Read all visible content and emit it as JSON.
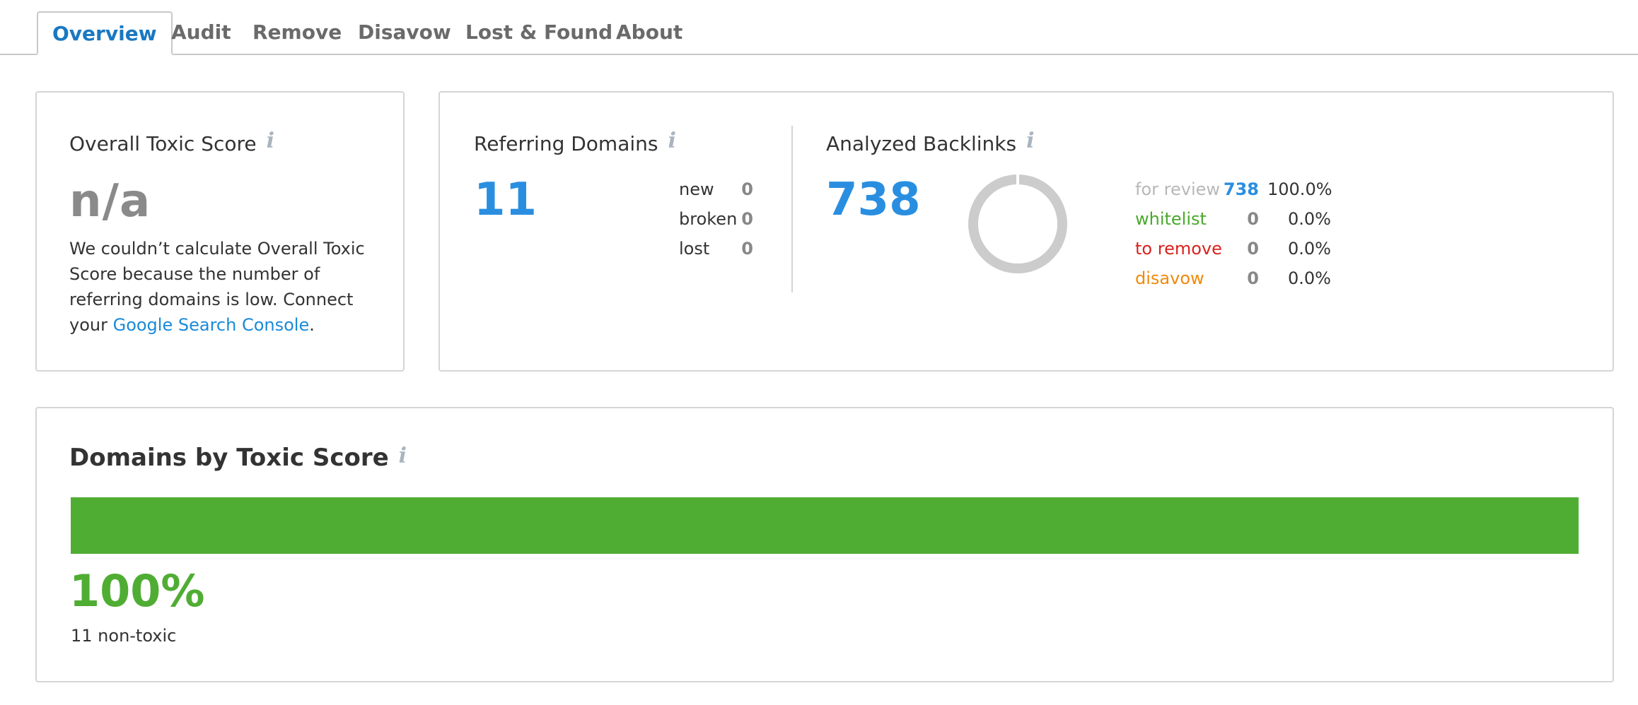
{
  "tabs": [
    {
      "label": "Overview",
      "active": true
    },
    {
      "label": "Audit"
    },
    {
      "label": "Remove"
    },
    {
      "label": "Disavow"
    },
    {
      "label": "Lost & Found"
    },
    {
      "label": "About"
    }
  ],
  "toxic_score": {
    "title": "Overall Toxic Score",
    "value": "n/a",
    "description": "We couldn’t calculate Overall Toxic Score because the number of referring domains is low. Connect your ",
    "link_text": "Google Search Console",
    "trailing": "."
  },
  "referring_domains": {
    "title": "Referring Domains",
    "value": "11",
    "stats": [
      {
        "label": "new",
        "value": "0"
      },
      {
        "label": "broken",
        "value": "0"
      },
      {
        "label": "lost",
        "value": "0"
      }
    ]
  },
  "analyzed_backlinks": {
    "title": "Analyzed Backlinks",
    "value": "738",
    "rows": [
      {
        "label": "for review",
        "count": "738",
        "pct": "100.0%",
        "label_color": "#b8b8b8",
        "count_color": "#2a8ee0"
      },
      {
        "label": "whitelist",
        "count": "0",
        "pct": "0.0%",
        "label_color": "#4aa92c",
        "count_color": "#888888"
      },
      {
        "label": "to remove",
        "count": "0",
        "pct": "0.0%",
        "label_color": "#d9231e",
        "count_color": "#888888"
      },
      {
        "label": "disavow",
        "count": "0",
        "pct": "0.0%",
        "label_color": "#f08a0a",
        "count_color": "#888888"
      }
    ],
    "donut": {
      "for_review_fraction": 1.0,
      "color": "#cccccc"
    }
  },
  "domains_by_toxic": {
    "title": "Domains by Toxic Score",
    "bar_fraction": 1.0,
    "bar_color": "#50ad34",
    "percent": "100%",
    "caption": "11 non-toxic"
  },
  "icons": {
    "info": "i"
  }
}
